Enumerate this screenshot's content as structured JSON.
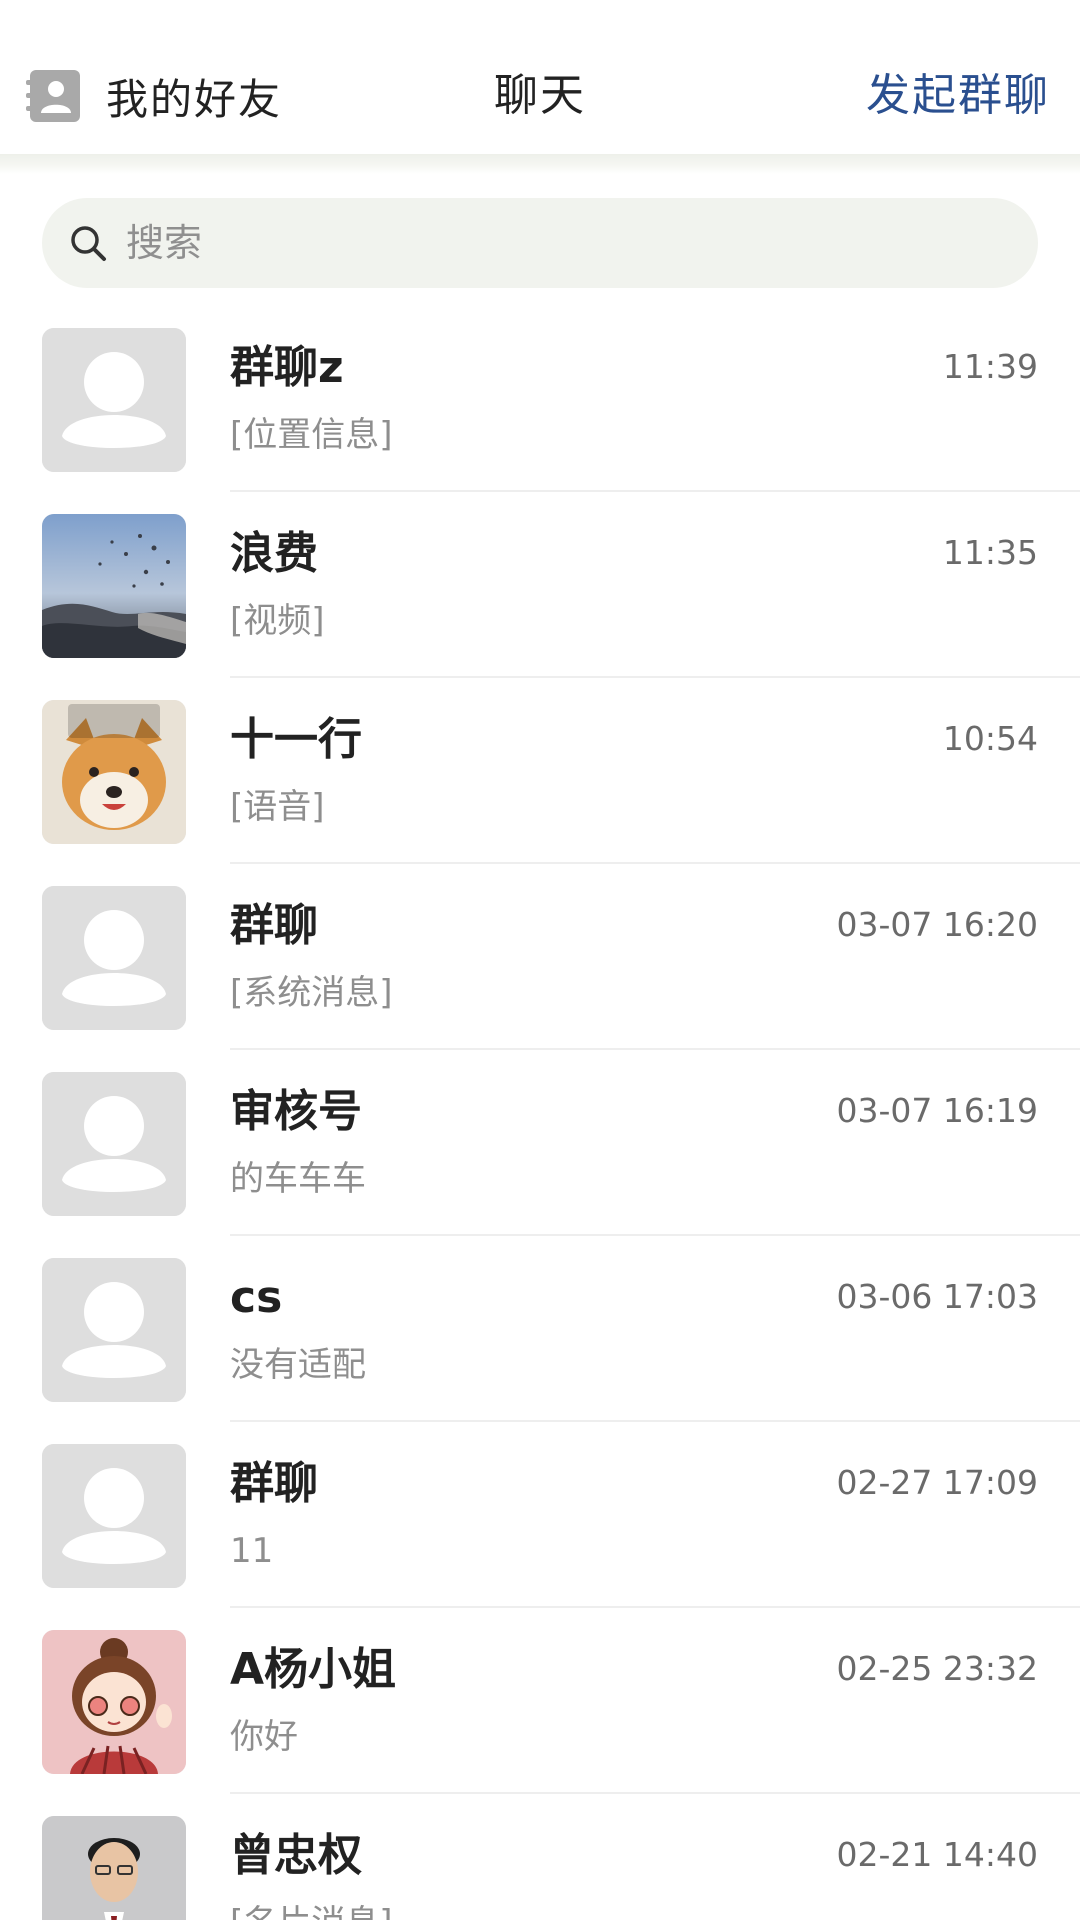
{
  "header": {
    "friends_label": "我的好友",
    "title": "聊天",
    "start_group_label": "发起群聊",
    "accent_color": "#2a4f8f"
  },
  "search": {
    "placeholder": "搜索"
  },
  "chats": [
    {
      "name": "群聊z",
      "preview": "[位置信息]",
      "time": "11:39",
      "avatar": "default-avatar"
    },
    {
      "name": "浪费",
      "preview": "[视频]",
      "time": "11:35",
      "avatar": "landscape-balloons-photo"
    },
    {
      "name": "十一行",
      "preview": "[语音]",
      "time": "10:54",
      "avatar": "shiba-dog-photo"
    },
    {
      "name": "群聊",
      "preview": "[系统消息]",
      "time": "03-07 16:20",
      "avatar": "default-avatar"
    },
    {
      "name": "审核号",
      "preview": "的车车车",
      "time": "03-07 16:19",
      "avatar": "default-avatar"
    },
    {
      "name": "cs",
      "preview": "没有适配",
      "time": "03-06 17:03",
      "avatar": "default-avatar"
    },
    {
      "name": "群聊",
      "preview": "11",
      "time": "02-27 17:09",
      "avatar": "default-avatar"
    },
    {
      "name": "A杨小姐",
      "preview": "你好",
      "time": "02-25 23:32",
      "avatar": "cartoon-girl-illustration"
    },
    {
      "name": "曾忠权",
      "preview": "[名片消息]",
      "time": "02-21 14:40",
      "avatar": "man-in-suit-photo"
    }
  ]
}
